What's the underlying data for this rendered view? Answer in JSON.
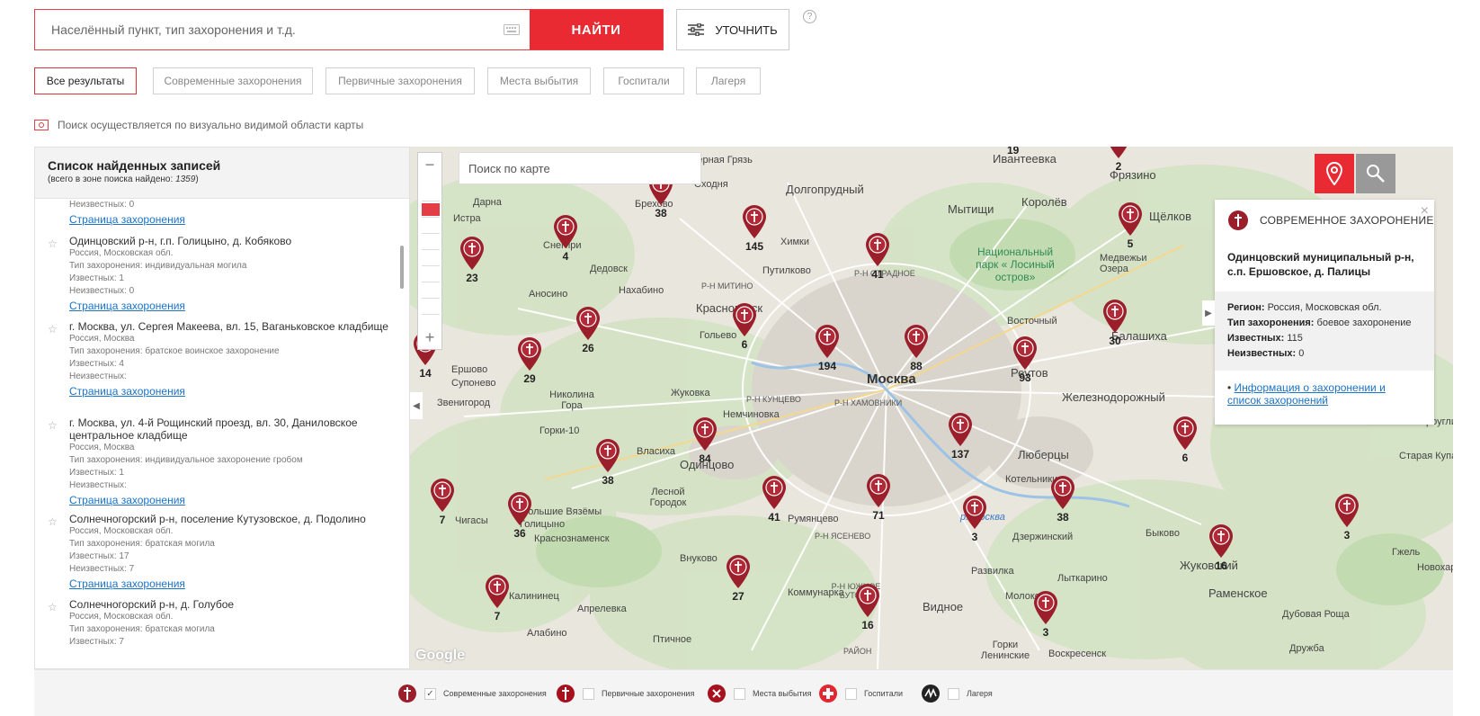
{
  "search": {
    "placeholder": "Населённый пункт, тип захоронения и т.д.",
    "find_label": "НАЙТИ",
    "refine_label": "УТОЧНИТЬ",
    "help": "?"
  },
  "filters": [
    "Все результаты",
    "Современные захоронения",
    "Первичные захоронения",
    "Места выбытия",
    "Госпитали",
    "Лагеря"
  ],
  "note": "Поиск осуществляется по визуально видимой области карты",
  "list": {
    "title": "Список найденных записей",
    "subtitle_prefix": "(всего в зоне поиска найдено: ",
    "count": "1359",
    "subtitle_suffix": ")",
    "top_fragment": {
      "line": "Неизвестных: 0",
      "link": "Страница захоронения"
    },
    "records": [
      {
        "title": "Одинцовский р-н, г.п. Голицыно, д. Кобяково",
        "lines": [
          "Россия, Московская обл.",
          "Тип захоронения: индивидуальная могила",
          "Известных: 1",
          "Неизвестных: 0"
        ],
        "link": "Страница захоронения"
      },
      {
        "title": "г. Москва, ул. Сергея Макеева, вл. 15, Ваганьковское кладбище",
        "lines": [
          "Россия, Москва",
          "Тип захоронения: братское воинское захоронение",
          "Известных: 4",
          "Неизвестных:"
        ],
        "link": "Страница захоронения"
      },
      {
        "title": "г. Москва, ул. 4-й Рощинский проезд, вл. 30, Даниловское центральное кладбище",
        "lines": [
          "Россия, Москва",
          "Тип захоронения: индивидуальное захоронение гробом",
          "Известных: 1",
          "Неизвестных:"
        ],
        "link": "Страница захоронения"
      },
      {
        "title": "Солнечногорский р-н, поселение Кутузовское, д. Подолино",
        "lines": [
          "Россия, Московская обл.",
          "Тип захоронения: братская могила",
          "Известных: 17",
          "Неизвестных: 7"
        ],
        "link": "Страница захоронения"
      },
      {
        "title": "Солнечногорский р-н, д. Голубое",
        "lines": [
          "Россия, Московская обл.",
          "Тип захоронения: братская могила",
          "Известных: 7"
        ],
        "link": ""
      }
    ]
  },
  "map": {
    "search_placeholder": "Поиск по карте",
    "google": "Google",
    "markers": [
      "38",
      "145",
      "41",
      "4",
      "23",
      "26",
      "6",
      "194",
      "88",
      "93",
      "30",
      "14",
      "29",
      "84",
      "137",
      "6",
      "38",
      "7",
      "36",
      "41",
      "71",
      "3",
      "38",
      "3",
      "16",
      "27",
      "7",
      "16",
      "3",
      "5",
      "2",
      "19"
    ],
    "places": [
      "Черная Грязь",
      "Сходня",
      "Долгопрудный",
      "Ивантеевка",
      "Фрязино",
      "Мытищи",
      "Королёв",
      "Щёлков",
      "Дарна",
      "Истра",
      "Снегири",
      "Брехово",
      "Химки",
      "Дедовск",
      "Путилково",
      "Р-Н ОТРАДНОЕ",
      "Национальный парк « Лосиный остров»",
      "Медвежьи Озера",
      "Аносино",
      "Нахабино",
      "Р-Н МИТИНО",
      "Красногорск",
      "Ершово",
      "Супонево",
      "Гольево",
      "Восточный",
      "Балашиха",
      "Москва",
      "Реутов",
      "Железнодорожный",
      "Звенигород",
      "Николина Гора",
      "Жуковка",
      "Р-Н КУНЦЕВО",
      "Немчиновка",
      "Р-Н ХАМОВНИКИ",
      "Горки-10",
      "Власиха",
      "Одинцово",
      "Люберцы",
      "Лесной Городок",
      "Котельники",
      "Чигасы",
      "Голицыно",
      "Большие Вязёмы",
      "Краснознаменск",
      "Внуково",
      "Румянцево",
      "Р-Н ЯСЕНЕВО",
      "р. Москва",
      "Дзержинский",
      "Развилка",
      "Быково",
      "Жуковский",
      "Гжель",
      "Новохаритоново",
      "Калининец",
      "Апрелевка",
      "Коммунарка",
      "Видное",
      "Лыткарино",
      "Молоково",
      "Раменское",
      "Дубовая Роща",
      "Алабино",
      "Птичное",
      "Р-Н ЮЖНОЕ БУТОВО",
      "Горки Ленинские",
      "Воскресенск",
      "Дружба",
      "РАЙОН",
      "Старая Купавна",
      "Электроугли"
    ],
    "popup": {
      "header": "СОВРЕМЕННОЕ ЗАХОРОНЕНИЕ",
      "close": "×",
      "title": "Одинцовский муниципальный р-н, с.п. Ершовское, д. Палицы",
      "region_label": "Регион:",
      "region": "Россия, Московская обл.",
      "type_label": "Тип захоронения:",
      "type": "боевое захоронение",
      "known_label": "Известных:",
      "known": "115",
      "unknown_label": "Неизвестных:",
      "unknown": "0",
      "link": "Информация о захоронении и список захоронений"
    }
  },
  "legend": [
    {
      "label": "Современные захоронения",
      "checked": "✓",
      "icon": "modern-burial-icon"
    },
    {
      "label": "Первичные захоронения",
      "checked": "",
      "icon": "primary-burial-icon"
    },
    {
      "label": "Места выбытия",
      "checked": "",
      "icon": "departure-place-icon"
    },
    {
      "label": "Госпитали",
      "checked": "",
      "icon": "hospital-icon"
    },
    {
      "label": "Лагеря",
      "checked": "",
      "icon": "camp-icon"
    }
  ],
  "colors": {
    "accent": "#ea2a33",
    "marker": "#9b1f2b",
    "link": "#1a73c8"
  }
}
